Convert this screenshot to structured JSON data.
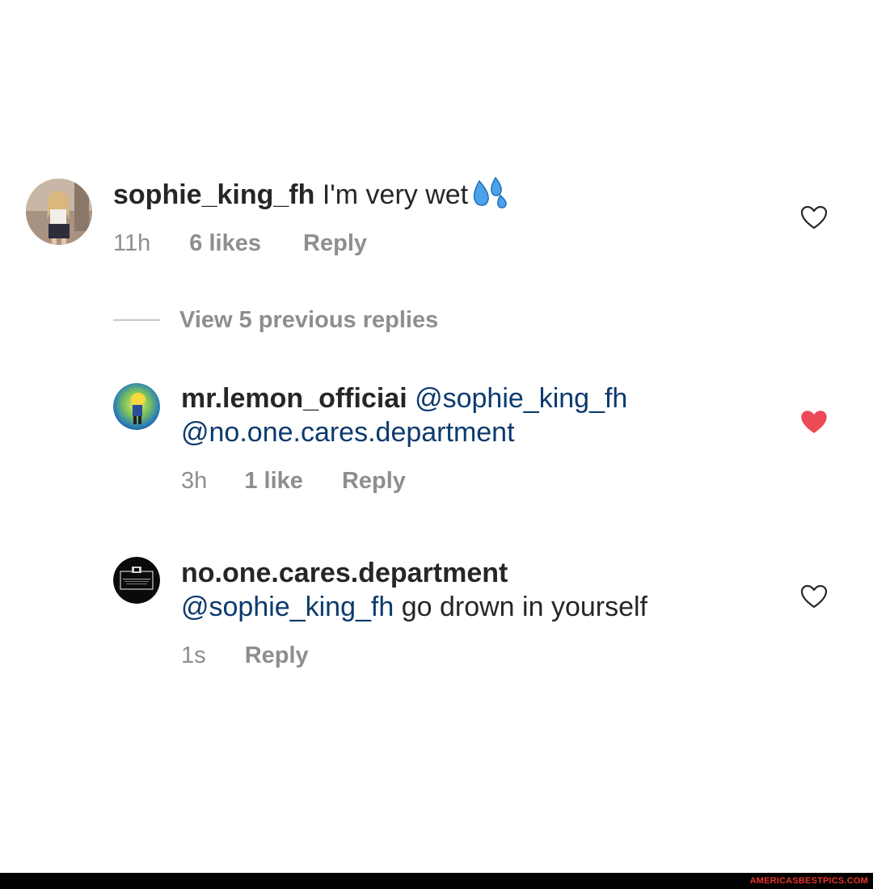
{
  "comments": [
    {
      "username": "sophie_king_fh",
      "text": "I'm very wet",
      "emoji": "sweat-droplets",
      "time": "11h",
      "likes": "6 likes",
      "reply": "Reply",
      "liked": false
    },
    {
      "username": "mr.lemon_officiai",
      "mention1": "@sophie_king_fh",
      "mention2": "@no.one.cares.department",
      "time": "3h",
      "likes": "1 like",
      "reply": "Reply",
      "liked": true
    },
    {
      "username": "no.one.cares.department",
      "mention": "@sophie_king_fh",
      "text": "go drown in yourself",
      "time": "1s",
      "reply": "Reply",
      "liked": false
    }
  ],
  "view_replies": "View 5 previous replies",
  "colors": {
    "mention": "#0b3a6e",
    "meta": "#8e8e8e",
    "heart_liked": "#ed4956"
  },
  "watermark": "AMERICASBESTPICS.COM"
}
